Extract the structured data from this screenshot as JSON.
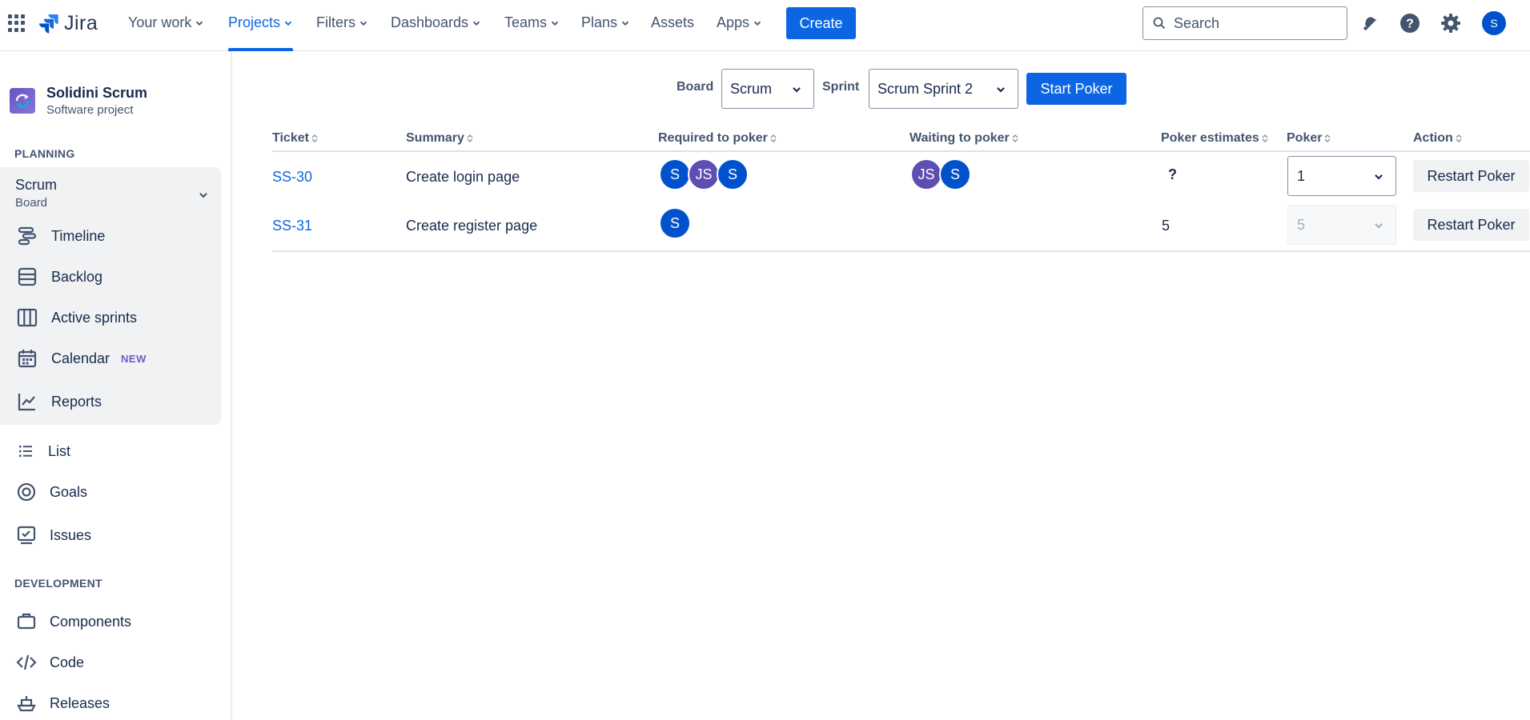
{
  "nav": {
    "logo_text": "Jira",
    "items": [
      {
        "label": "Your work"
      },
      {
        "label": "Projects"
      },
      {
        "label": "Filters"
      },
      {
        "label": "Dashboards"
      },
      {
        "label": "Teams"
      },
      {
        "label": "Plans"
      },
      {
        "label": "Assets"
      },
      {
        "label": "Apps"
      }
    ],
    "create_label": "Create",
    "search_placeholder": "Search",
    "user_initial": "S",
    "accent_color": "#0c66e4"
  },
  "sidebar": {
    "project_name": "Solidini Scrum",
    "project_type": "Software project",
    "planning_title": "PLANNING",
    "board_item": {
      "title": "Scrum",
      "subtitle": "Board"
    },
    "planning_items": [
      {
        "label": "Timeline",
        "icon": "timeline-icon"
      },
      {
        "label": "Backlog",
        "icon": "backlog-icon"
      },
      {
        "label": "Active sprints",
        "icon": "board-columns-icon"
      },
      {
        "label": "Calendar",
        "icon": "calendar-icon",
        "badge": "NEW"
      },
      {
        "label": "Reports",
        "icon": "reports-chart-icon"
      }
    ],
    "other_items": [
      {
        "label": "List",
        "icon": "list-icon"
      },
      {
        "label": "Goals",
        "icon": "goals-target-icon"
      },
      {
        "label": "Issues",
        "icon": "issues-icon"
      }
    ],
    "development_title": "DEVELOPMENT",
    "development_items": [
      {
        "label": "Components",
        "icon": "components-icon"
      },
      {
        "label": "Code",
        "icon": "code-icon"
      },
      {
        "label": "Releases",
        "icon": "releases-icon"
      }
    ]
  },
  "filters": {
    "board_label": "Board",
    "board_value": "Scrum",
    "sprint_label": "Sprint",
    "sprint_value": "Scrum Sprint 2",
    "start_label": "Start Poker"
  },
  "table": {
    "columns": [
      "Ticket",
      "Summary",
      "Required to poker",
      "Waiting to poker",
      "Poker estimates",
      "Poker",
      "Action"
    ],
    "rows": [
      {
        "ticket": "SS-30",
        "summary": "Create login page",
        "required": [
          {
            "initials": "S",
            "color": "#0052cc"
          },
          {
            "initials": "JS",
            "color": "#5e4db2"
          },
          {
            "initials": "S",
            "color": "#0052cc"
          }
        ],
        "waiting": [
          {
            "initials": "JS",
            "color": "#5e4db2"
          },
          {
            "initials": "S",
            "color": "#0052cc"
          }
        ],
        "estimate": "?",
        "poker_value": "1",
        "poker_enabled": true,
        "action": "Restart Poker"
      },
      {
        "ticket": "SS-31",
        "summary": "Create register page",
        "required": [
          {
            "initials": "S",
            "color": "#0052cc"
          }
        ],
        "waiting": [],
        "estimate": "5",
        "poker_value": "5",
        "poker_enabled": false,
        "action": "Restart Poker"
      }
    ]
  }
}
